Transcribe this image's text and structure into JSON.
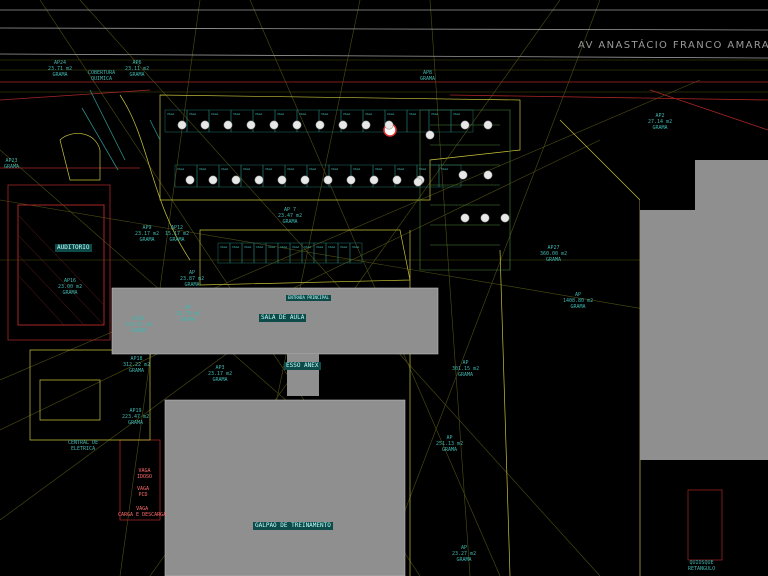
{
  "street_name": "AV  ANASTÁCIO FRANCO  AMARAL",
  "buildings": {
    "auditorio": "AUDITORIO",
    "sala_de_aula": "SALA DE AULA",
    "acesso_anexo": "ESSO ANEX",
    "galpao": "GALPAO DE TREINAMENTO",
    "quiosque": "QUIOSQUE\nRETANGULO",
    "central_eletrica": "CENTRAL DE\nELETRICA",
    "entrada": "ENTRADA PRINCIPAL"
  },
  "areas": [
    {
      "key": "ap24",
      "text": "AP24\n23.71 m2\nGRAMA"
    },
    {
      "key": "cobertura",
      "text": "COBERTURA\nQUIMICA"
    },
    {
      "key": "ap6",
      "text": "AP6\n23.11 m2\nGRAMA"
    },
    {
      "key": "ap8",
      "text": "AP8\nGRAMA"
    },
    {
      "key": "ap2",
      "text": "AP2\n27.14 m2\nGRAMA"
    },
    {
      "key": "ap23",
      "text": "AP23\nGRAMA"
    },
    {
      "key": "ap9",
      "text": "AP9\n23.17 m2\nGRAMA"
    },
    {
      "key": "ap_mid",
      "text": "AP 7\n23.47 m2\nGRAMA"
    },
    {
      "key": "ap12",
      "text": "AP12\n15.17 m2\nGRAMA"
    },
    {
      "key": "ap_aud",
      "text": "AP16\n23.00 m2\nGRAMA"
    },
    {
      "key": "ap27",
      "text": "AP27\n360.00 m2\nGRAMA"
    },
    {
      "key": "ap_big",
      "text": "AP\n1408.80 m2\nGRAMA"
    },
    {
      "key": "ap_r1",
      "text": "AP3\n23.17 m2\nGRAMA"
    },
    {
      "key": "ap_r2",
      "text": "AP\n301.15 m2\nGRAMA"
    },
    {
      "key": "ap_r3",
      "text": "AP\n251.13 m2\nGRAMA"
    },
    {
      "key": "ap_l1",
      "text": "AP18\n312.22 m2\nGRAMA"
    },
    {
      "key": "ap_l2",
      "text": "AP19\n223.47 m2\nGRAMA"
    },
    {
      "key": "ap_l3",
      "text": "AP10\n223.67 m2\nGRAMA"
    },
    {
      "key": "ap_c1",
      "text": "AP\n23.79 m2\nGRAMA"
    },
    {
      "key": "ap_c2",
      "text": "AP\n23.87 m2\nGRAMA"
    },
    {
      "key": "ap_c3",
      "text": "AP\n23.27 m2\nGRAMA"
    }
  ],
  "small_labels": [
    {
      "key": "vaga1",
      "text": "VAGA\nIDOSO"
    },
    {
      "key": "vaga2",
      "text": "VAGA\nPCD"
    },
    {
      "key": "vaga3",
      "text": "VAGA\nCARGA E DESCARGA"
    }
  ],
  "parking_spot_label": "VAGA",
  "colors": {
    "cyan": "#3fb7b0",
    "yellow": "#c8c23a",
    "red": "#b02a2a",
    "gray": "#8f8f8f",
    "green": "#4a8a3a"
  }
}
